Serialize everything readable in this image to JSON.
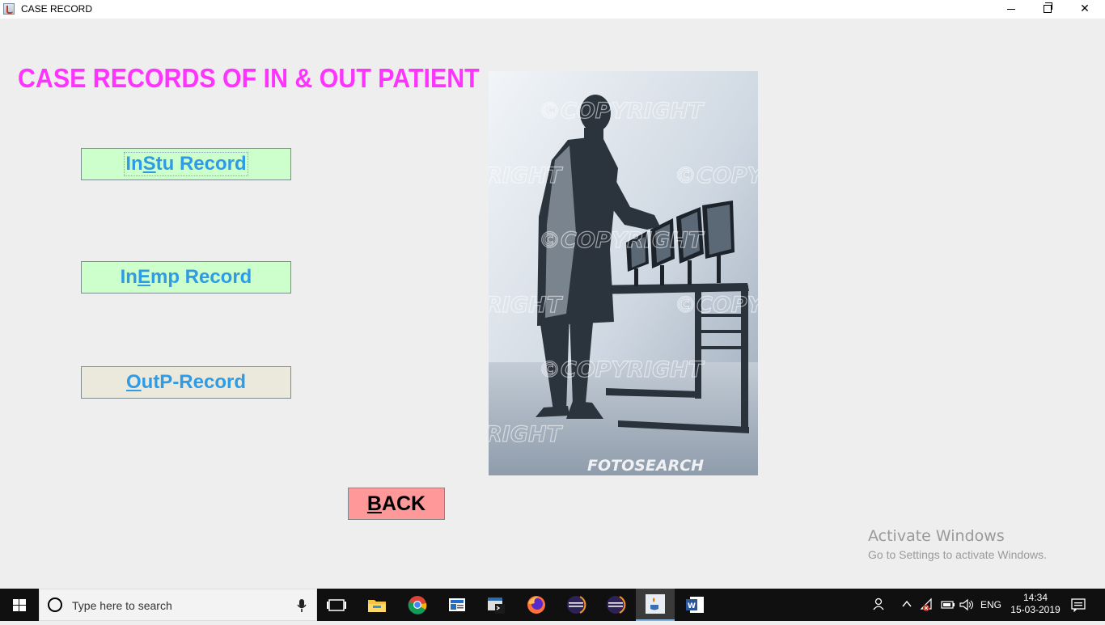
{
  "window": {
    "title": "CASE RECORD",
    "controls": [
      "minimize",
      "restore",
      "close"
    ]
  },
  "main": {
    "heading": "CASE RECORDS OF IN & OUT PATIENT",
    "buttons": {
      "instu": {
        "pre": "In",
        "mnemonic": "S",
        "post": "tu Record"
      },
      "inemp": {
        "pre": "In",
        "mnemonic": "E",
        "post": "mp Record"
      },
      "outp": {
        "pre": "",
        "mnemonic": "O",
        "post": "utP-Record"
      },
      "back": {
        "pre": "",
        "mnemonic": "B",
        "post": "ACK"
      }
    },
    "colors": {
      "heading": "#ff33ff",
      "button_text": "#2d9be6",
      "green_button": "#ccffcc",
      "outp_button": "#ebe9db",
      "back_button": "#ff9999"
    },
    "photo": {
      "watermark_text": "©COPYRIGHT",
      "watermark_fragment_1": "RIGHT",
      "watermark_fragment_2": "©COPY",
      "brand": "FOTOSEARCH"
    }
  },
  "activation": {
    "title": "Activate Windows",
    "subtitle": "Go to Settings to activate Windows."
  },
  "taskbar": {
    "search_placeholder": "Type here to search",
    "apps": [
      "task-view",
      "file-explorer",
      "chrome",
      "outlook",
      "terminal-app",
      "firefox",
      "eclipse",
      "eclipse",
      "java-app",
      "word"
    ],
    "language": "ENG",
    "time": "14:34",
    "date": "15-03-2019"
  }
}
